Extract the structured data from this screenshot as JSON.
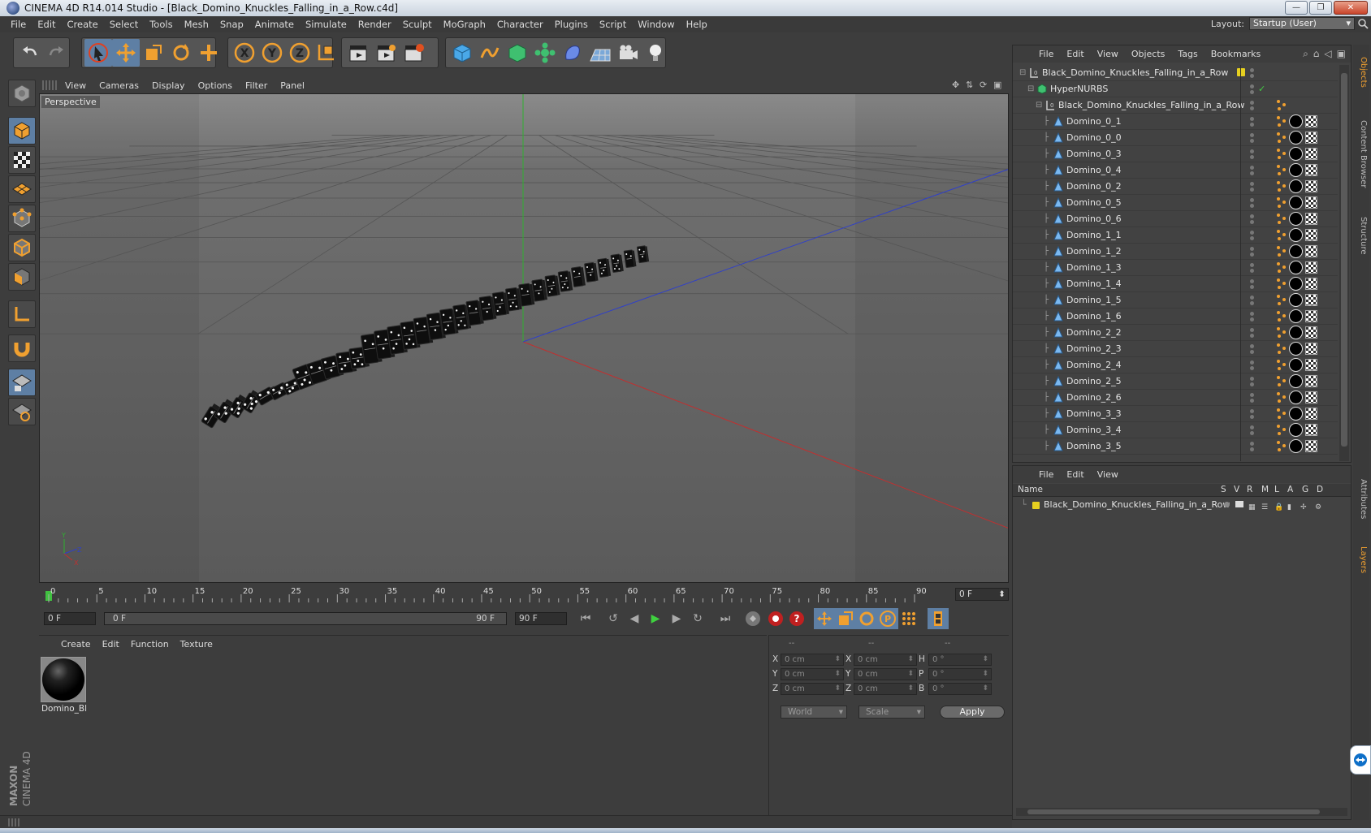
{
  "window": {
    "title": "CINEMA 4D R14.014 Studio - [Black_Domino_Knuckles_Falling_in_a_Row.c4d]",
    "controls": [
      "—",
      "❐",
      "✕"
    ]
  },
  "menubar": {
    "items": [
      "File",
      "Edit",
      "Create",
      "Select",
      "Tools",
      "Mesh",
      "Snap",
      "Animate",
      "Simulate",
      "Render",
      "Sculpt",
      "MoGraph",
      "Character",
      "Plugins",
      "Script",
      "Window",
      "Help"
    ],
    "layout_label": "Layout:",
    "layout_value": "Startup (User)"
  },
  "viewport": {
    "menu": [
      "View",
      "Cameras",
      "Display",
      "Options",
      "Filter",
      "Panel"
    ],
    "label": "Perspective",
    "axis_labels": {
      "y": "Y",
      "z": "Z",
      "x": "X"
    }
  },
  "timeline": {
    "ticks": [
      "0",
      "5",
      "10",
      "15",
      "20",
      "25",
      "30",
      "35",
      "40",
      "45",
      "50",
      "55",
      "60",
      "65",
      "70",
      "75",
      "80",
      "85",
      "90"
    ],
    "current_frame": "0 F"
  },
  "transport": {
    "start_field": "0 F",
    "range_start": "0 F",
    "range_end": "90 F",
    "end_field": "90 F"
  },
  "material_panel": {
    "menu": [
      "Create",
      "Edit",
      "Function",
      "Texture"
    ],
    "material_name": "Domino_Bl"
  },
  "coord_panel": {
    "headers": [
      "--",
      "--",
      "--"
    ],
    "rows": [
      {
        "l1": "X",
        "v1": "0 cm",
        "l2": "X",
        "v2": "0 cm",
        "l3": "H",
        "v3": "0 °"
      },
      {
        "l1": "Y",
        "v1": "0 cm",
        "l2": "Y",
        "v2": "0 cm",
        "l3": "P",
        "v3": "0 °"
      },
      {
        "l1": "Z",
        "v1": "0 cm",
        "l2": "Z",
        "v2": "0 cm",
        "l3": "B",
        "v3": "0 °"
      }
    ],
    "world": "World",
    "scale": "Scale",
    "apply": "Apply"
  },
  "object_manager": {
    "menu": [
      "File",
      "Edit",
      "View",
      "Objects",
      "Tags",
      "Bookmarks"
    ],
    "rows": [
      {
        "name": "Black_Domino_Knuckles_Falling_in_a_Row",
        "level": 0,
        "type": "null"
      },
      {
        "name": "HyperNURBS",
        "level": 1,
        "type": "nurbs"
      },
      {
        "name": "Black_Domino_Knuckles_Falling_in_a_Row",
        "level": 2,
        "type": "null"
      },
      {
        "name": "Domino_0_1",
        "level": 3,
        "type": "poly"
      },
      {
        "name": "Domino_0_0",
        "level": 3,
        "type": "poly"
      },
      {
        "name": "Domino_0_3",
        "level": 3,
        "type": "poly"
      },
      {
        "name": "Domino_0_4",
        "level": 3,
        "type": "poly"
      },
      {
        "name": "Domino_0_2",
        "level": 3,
        "type": "poly"
      },
      {
        "name": "Domino_0_5",
        "level": 3,
        "type": "poly"
      },
      {
        "name": "Domino_0_6",
        "level": 3,
        "type": "poly"
      },
      {
        "name": "Domino_1_1",
        "level": 3,
        "type": "poly"
      },
      {
        "name": "Domino_1_2",
        "level": 3,
        "type": "poly"
      },
      {
        "name": "Domino_1_3",
        "level": 3,
        "type": "poly"
      },
      {
        "name": "Domino_1_4",
        "level": 3,
        "type": "poly"
      },
      {
        "name": "Domino_1_5",
        "level": 3,
        "type": "poly"
      },
      {
        "name": "Domino_1_6",
        "level": 3,
        "type": "poly"
      },
      {
        "name": "Domino_2_2",
        "level": 3,
        "type": "poly"
      },
      {
        "name": "Domino_2_3",
        "level": 3,
        "type": "poly"
      },
      {
        "name": "Domino_2_4",
        "level": 3,
        "type": "poly"
      },
      {
        "name": "Domino_2_5",
        "level": 3,
        "type": "poly"
      },
      {
        "name": "Domino_2_6",
        "level": 3,
        "type": "poly"
      },
      {
        "name": "Domino_3_3",
        "level": 3,
        "type": "poly"
      },
      {
        "name": "Domino_3_4",
        "level": 3,
        "type": "poly"
      },
      {
        "name": "Domino_3_5",
        "level": 3,
        "type": "poly"
      }
    ]
  },
  "layer_manager": {
    "menu": [
      "File",
      "Edit",
      "View"
    ],
    "columns": [
      "Name",
      "S",
      "V",
      "R",
      "M",
      "L",
      "A",
      "G",
      "D"
    ],
    "layer_name": "Black_Domino_Knuckles_Falling_in_a_Row"
  },
  "side_tabs": [
    "Objects",
    "Content Browser",
    "Structure",
    "Attributes",
    "Layers"
  ],
  "brand": {
    "maxon": "MAXON",
    "cinema": "CINEMA 4D"
  },
  "colors": {
    "accent": "#f0a030",
    "selection_blue": "#5e7fa4",
    "layer_yellow": "#e6d020",
    "axis_x": "#c03030",
    "axis_y": "#30b030",
    "axis_z": "#3040c8"
  }
}
